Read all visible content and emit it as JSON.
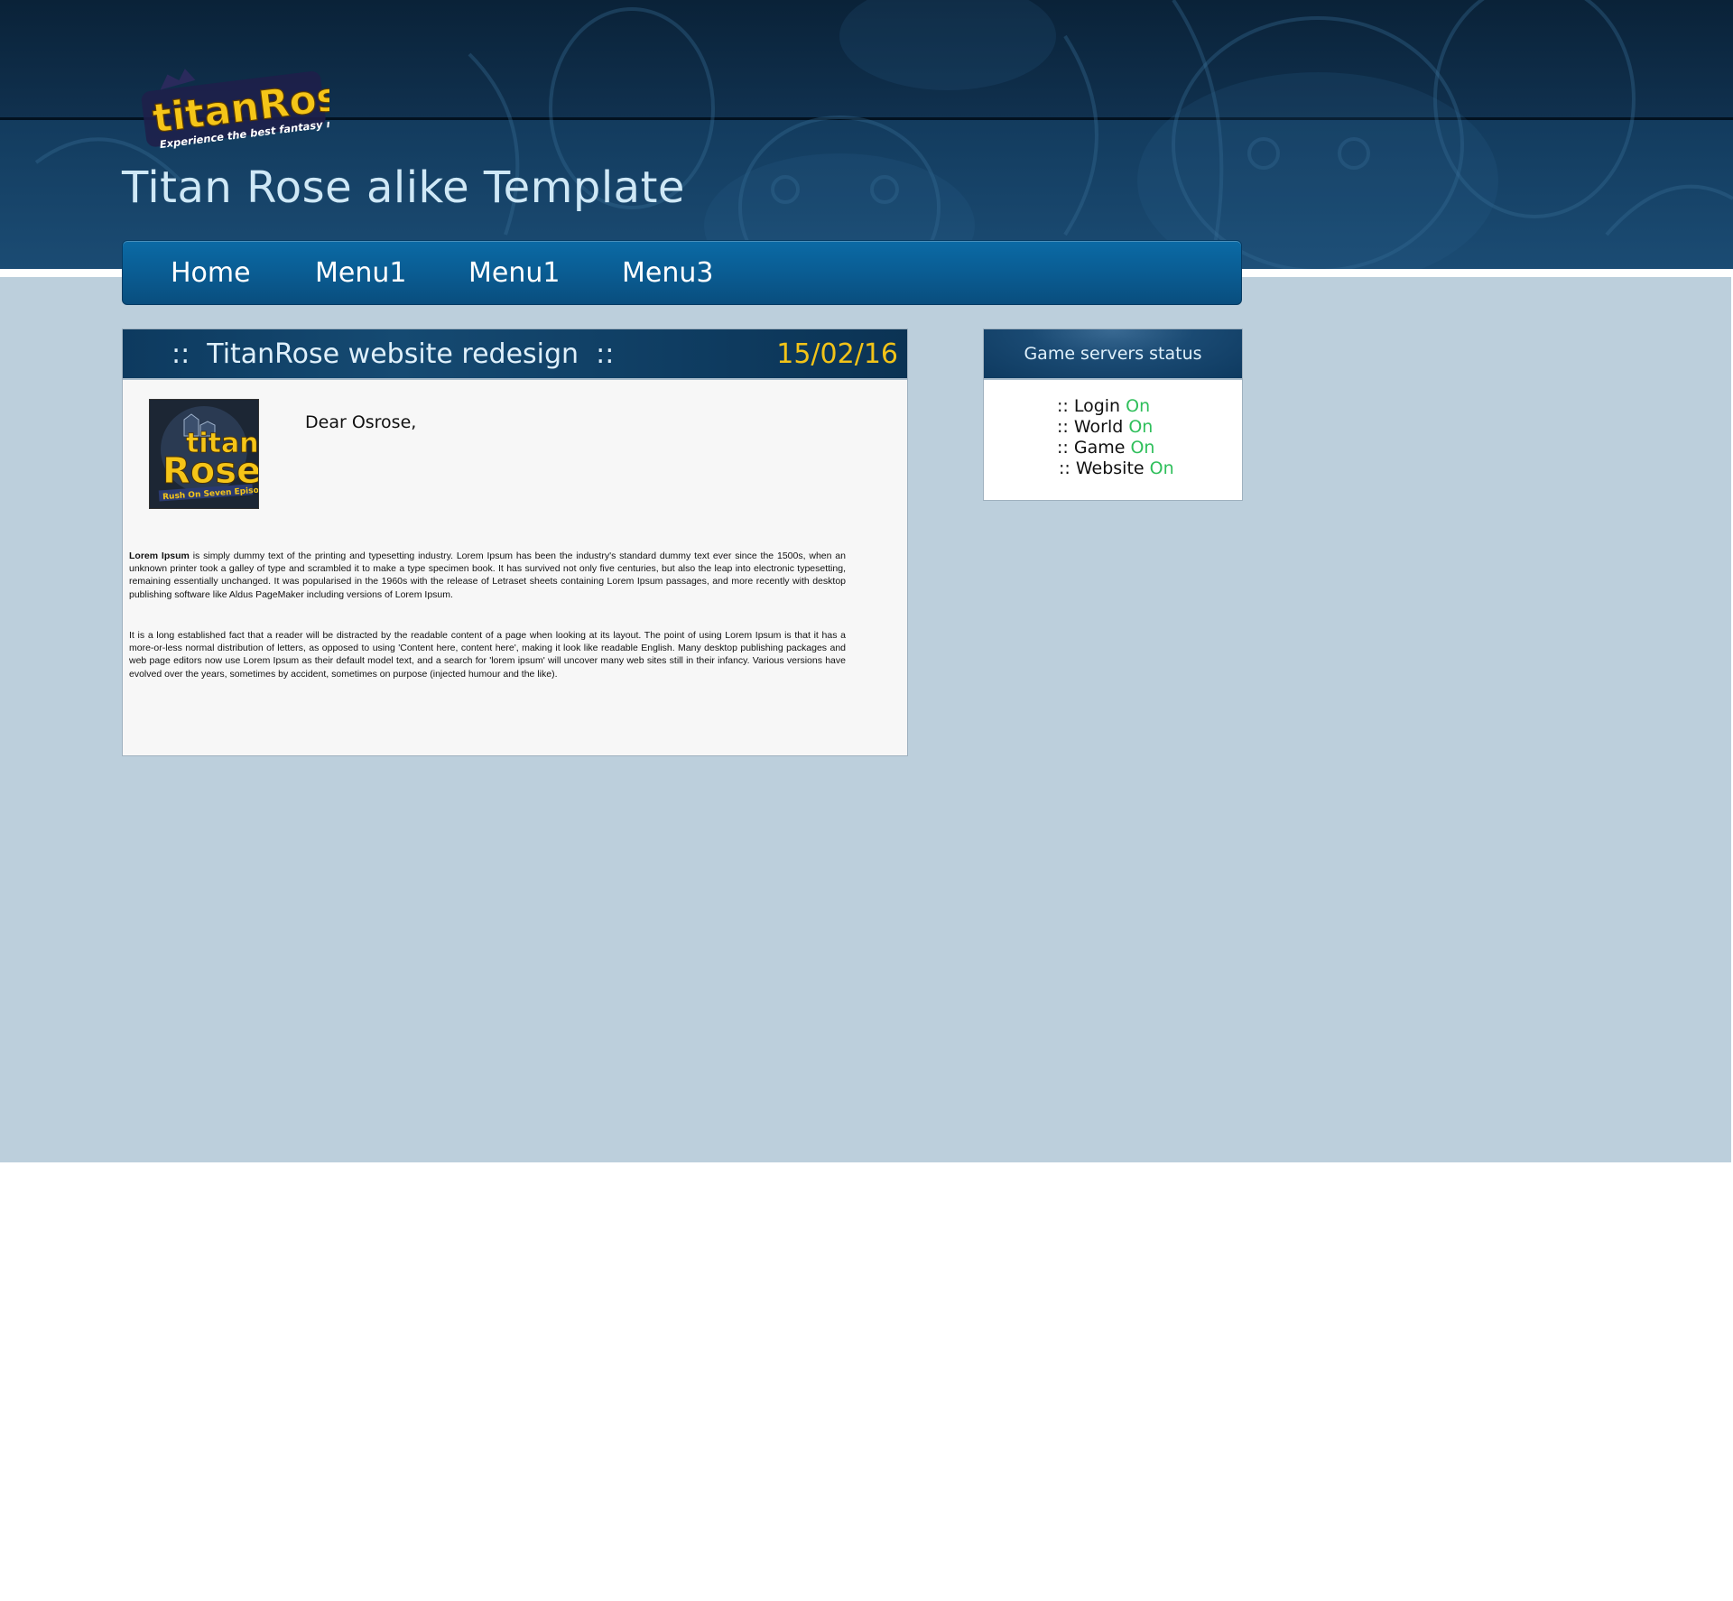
{
  "header": {
    "logo": {
      "word1": "titan",
      "word2": "Rose",
      "tagline": "Experience the best fantasy mmorpg"
    },
    "site_title": "Titan Rose alike Template"
  },
  "nav": {
    "items": [
      {
        "label": "Home"
      },
      {
        "label": "Menu1"
      },
      {
        "label": "Menu1"
      },
      {
        "label": "Menu3"
      }
    ]
  },
  "article": {
    "title": "::  TitanRose website redesign  ::",
    "date": "15/02/16",
    "thumbnail": {
      "word1": "titan",
      "word2": "Rose",
      "caption": "Rush On Seven Episodes"
    },
    "greeting": "Dear Osrose,",
    "paragraph1_lead": "Lorem Ipsum",
    "paragraph1_rest": " is simply dummy text of the printing and typesetting industry. Lorem Ipsum has been the industry's standard dummy text ever since the 1500s, when an unknown printer took a galley of type and scrambled it to make a type specimen book. It has survived not only five centuries, but also the leap into electronic typesetting, remaining essentially unchanged. It was popularised in the 1960s with the release of Letraset sheets containing Lorem Ipsum passages, and more recently with desktop publishing software like Aldus PageMaker including versions of Lorem Ipsum.",
    "paragraph2": "It is a long established fact that a reader will be distracted by the readable content of a page when looking at its layout. The point of using Lorem Ipsum is that it has a more-or-less normal distribution of letters, as opposed to using 'Content here, content here', making it look like readable English. Many desktop publishing packages and web page editors now use Lorem Ipsum as their default model text, and a search for 'lorem ipsum' will uncover many web sites still in their infancy. Various versions have evolved over the years, sometimes by accident, sometimes on purpose (injected humour and the like)."
  },
  "server_status": {
    "title": "Game servers status",
    "rows": [
      {
        "label": ":: Login ",
        "status": "On"
      },
      {
        "label": ":: World ",
        "status": "On"
      },
      {
        "label": ":: Game ",
        "status": "On"
      },
      {
        "label": ":: Website ",
        "status": "On"
      }
    ]
  },
  "colors": {
    "header_bg": "#123a5c",
    "nav_bg": "#0a5e95",
    "main_bg": "#bccfdc",
    "date_yellow": "#f2c318",
    "status_on_green": "#2fbf5b",
    "logo_yellow": "#f5c518"
  }
}
